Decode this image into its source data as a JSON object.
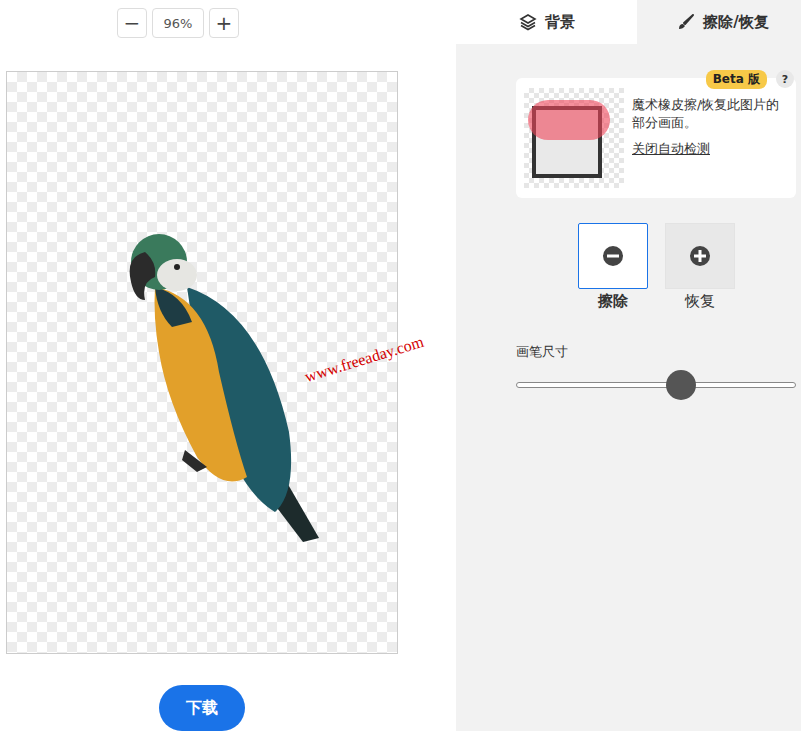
{
  "zoom": {
    "minus": "−",
    "value": "96%",
    "plus": "+"
  },
  "tabs": [
    {
      "label": "背景",
      "selected": false
    },
    {
      "label": "擦除/恢复",
      "selected": true
    }
  ],
  "watermark": "www.freeaday.com",
  "download": "下载",
  "info_card": {
    "badge": "Beta 版",
    "help": "?",
    "text": "魔术橡皮擦/恢复此图片的部分画面。",
    "link": "关闭自动检测"
  },
  "modes": [
    {
      "label": "擦除",
      "selected": true,
      "kind": "erase"
    },
    {
      "label": "恢复",
      "selected": false,
      "kind": "restore"
    }
  ],
  "brush": {
    "label": "画笔尺寸",
    "level": 0.59
  }
}
